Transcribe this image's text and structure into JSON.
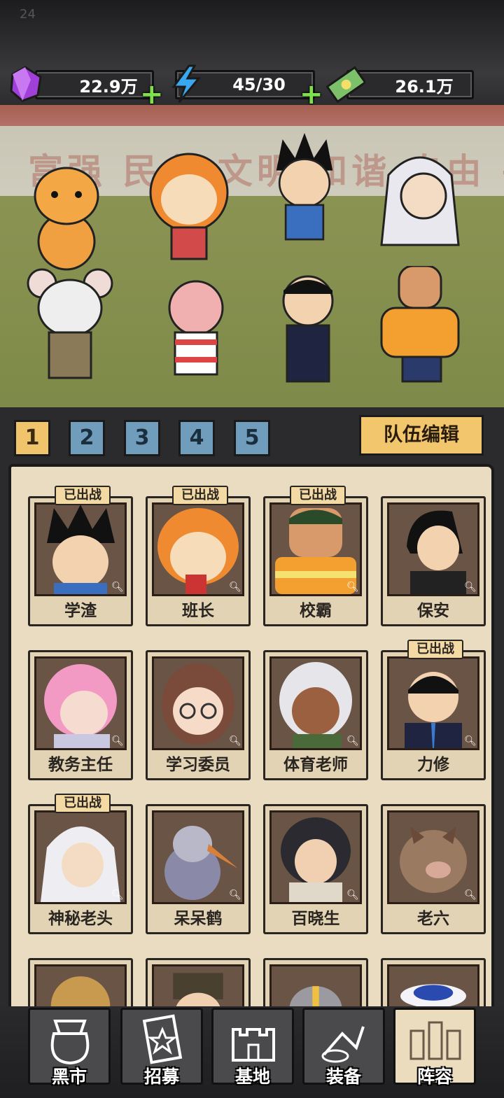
{
  "status_bar": {
    "time": "24"
  },
  "resources": {
    "gems": {
      "value": "22.9万",
      "icon": "purple-gem-icon"
    },
    "energy": {
      "value": "45/30",
      "icon": "lightning-icon"
    },
    "cash": {
      "value": "26.1万",
      "icon": "banknote-icon"
    }
  },
  "scene": {
    "wall_slogan": "富强 民主 文明 和谐 自由 平等"
  },
  "team_tabs": [
    "1",
    "2",
    "3",
    "4",
    "5"
  ],
  "active_team": "1",
  "edit_team_label": "队伍编辑",
  "deployed_label": "已出战",
  "roster": [
    {
      "name": "学渣",
      "deployed": true
    },
    {
      "name": "班长",
      "deployed": true
    },
    {
      "name": "校霸",
      "deployed": true
    },
    {
      "name": "保安",
      "deployed": false
    },
    {
      "name": "教务主任",
      "deployed": false
    },
    {
      "name": "学习委员",
      "deployed": false
    },
    {
      "name": "体育老师",
      "deployed": false
    },
    {
      "name": "力修",
      "deployed": true
    },
    {
      "name": "神秘老头",
      "deployed": true
    },
    {
      "name": "呆呆鹤",
      "deployed": false
    },
    {
      "name": "百晓生",
      "deployed": false
    },
    {
      "name": "老六",
      "deployed": false
    }
  ],
  "nav": [
    {
      "label": "黑市",
      "icon": "money-bag-icon"
    },
    {
      "label": "招募",
      "icon": "card-icon"
    },
    {
      "label": "基地",
      "icon": "castle-icon"
    },
    {
      "label": "装备",
      "icon": "equipment-icon"
    },
    {
      "label": "阵容",
      "icon": "lineup-icon",
      "active": true
    }
  ],
  "colors": {
    "tab_active": "#f0c46a",
    "tab_inactive": "#6f9dbb",
    "plus": "#7ee04a",
    "panel": "#e9dcc1"
  }
}
